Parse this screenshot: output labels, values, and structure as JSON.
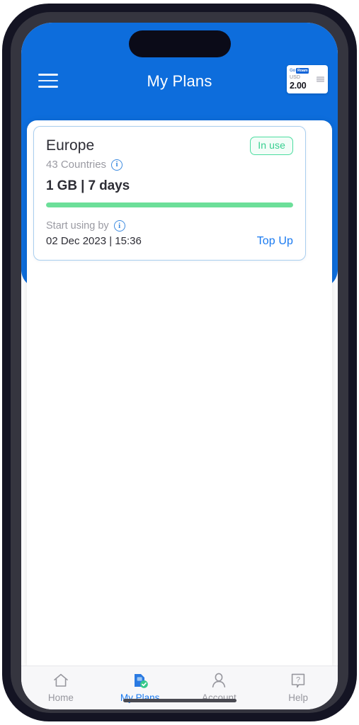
{
  "header": {
    "title": "My Plans",
    "menu_icon": "hamburger-menu-icon",
    "balance": {
      "logo_word": "Go",
      "logo_chip": "Roam",
      "currency": "USD",
      "amount": "2.00",
      "flag_icon": "flag-icon"
    }
  },
  "plan_card": {
    "name": "Europe",
    "status_badge": "In use",
    "countries": "43 Countries",
    "countries_info_icon": "info-icon",
    "quota": "1 GB | 7 days",
    "progress_percent": 100,
    "progress_color": "#6cdf99",
    "start_label": "Start using by",
    "start_info_icon": "info-icon",
    "start_date": "02 Dec 2023 | 15:36",
    "topup_label": "Top Up"
  },
  "tabs": [
    {
      "label": "Home",
      "icon": "home-icon",
      "active": false
    },
    {
      "label": "My Plans",
      "icon": "sim-card-check-icon",
      "active": true
    },
    {
      "label": "Account",
      "icon": "person-icon",
      "active": false
    },
    {
      "label": "Help",
      "icon": "question-bubble-icon",
      "active": false
    }
  ],
  "colors": {
    "brand_blue": "#0d6ddc",
    "link_blue": "#1a7af0",
    "status_green": "#36cf90",
    "progress_green": "#6cdf99"
  }
}
